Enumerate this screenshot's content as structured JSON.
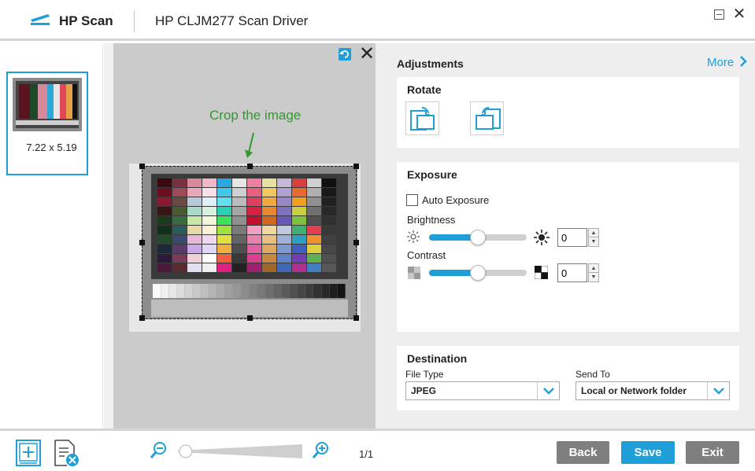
{
  "app": {
    "name": "HP Scan",
    "driver": "HP CLJM277 Scan Driver"
  },
  "thumbnail": {
    "size_label": "7.22  x  5.19"
  },
  "preview": {
    "crop_hint": "Crop the image"
  },
  "adjustments": {
    "title": "Adjustments",
    "more_label": "More",
    "rotate": {
      "title": "Rotate"
    },
    "exposure": {
      "title": "Exposure",
      "auto_exposure_label": "Auto Exposure",
      "auto_exposure_checked": false,
      "brightness_label": "Brightness",
      "brightness_value": "0",
      "brightness_level": 0.5,
      "contrast_label": "Contrast",
      "contrast_value": "0",
      "contrast_level": 0.5
    },
    "destination": {
      "title": "Destination",
      "file_type_label": "File Type",
      "file_type_value": "JPEG",
      "send_to_label": "Send To",
      "send_to_value": "Local or Network folder"
    }
  },
  "bottom": {
    "page_count": "1/1",
    "zoom_level": 0.05,
    "back_label": "Back",
    "save_label": "Save",
    "exit_label": "Exit"
  },
  "colors": {
    "accent": "#1e9fd8",
    "hint_green": "#2e9b2e",
    "button_gray": "#7f7f7f"
  },
  "icons": {
    "logo": "hp-scanner-icon",
    "rotate_left": "rotate-left-icon",
    "rotate_right": "rotate-right-icon",
    "undo": "undo-rotate-icon",
    "zoom_out": "zoom-out-icon",
    "zoom_in": "zoom-in-icon",
    "add_page": "add-page-icon",
    "delete_page": "delete-page-icon"
  }
}
